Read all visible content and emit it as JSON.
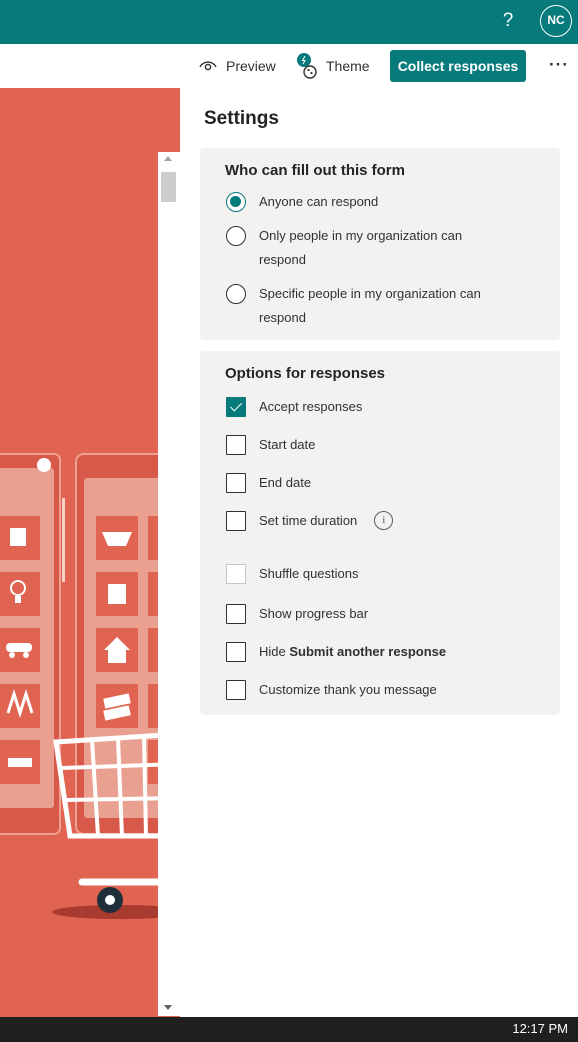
{
  "header": {
    "help_icon": "question-mark-icon",
    "help_label": "?",
    "avatar_initials": "NC",
    "accent_color": "#077a7c"
  },
  "toolbar": {
    "preview_label": "Preview",
    "preview_icon": "eye-icon",
    "theme_label": "Theme",
    "theme_icon": "palette-icon",
    "collect_label": "Collect responses",
    "more_label": "···",
    "more_icon": "ellipsis-icon"
  },
  "canvas": {
    "background_color": "#e06451"
  },
  "settings": {
    "title": "Settings",
    "who": {
      "title": "Who can fill out this form",
      "options": [
        {
          "label": "Anyone can respond",
          "selected": true
        },
        {
          "label": "Only people in my organization can respond",
          "selected": false
        },
        {
          "label": "Specific people in my organization can respond",
          "selected": false
        }
      ]
    },
    "responses": {
      "title": "Options for responses",
      "options": [
        {
          "label": "Accept responses",
          "checked": true
        },
        {
          "label": "Start date",
          "checked": false
        },
        {
          "label": "End date",
          "checked": false
        },
        {
          "label": "Set time duration",
          "checked": false,
          "info_icon": "info-icon",
          "info_label": "i"
        },
        {
          "label": "Shuffle questions",
          "checked": false,
          "disabled": true
        },
        {
          "label": "Show progress bar",
          "checked": false
        },
        {
          "label_prefix": "Hide ",
          "label_bold": "Submit another response",
          "checked": false
        },
        {
          "label": "Customize thank you message",
          "checked": false
        }
      ]
    }
  },
  "taskbar": {
    "clock": "12:17 PM"
  }
}
